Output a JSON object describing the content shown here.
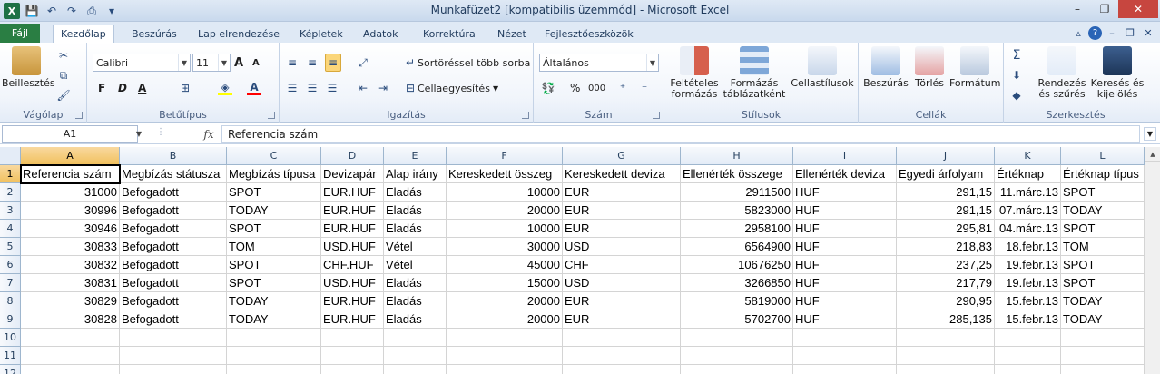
{
  "window": {
    "title": "Munkafüzet2  [kompatibilis üzemmód]  -  Microsoft Excel",
    "minimize": "–",
    "restore": "❐",
    "close": "✕"
  },
  "tabs": [
    {
      "label": "Fájl"
    },
    {
      "label": "Kezdőlap"
    },
    {
      "label": "Beszúrás"
    },
    {
      "label": "Lap elrendezése"
    },
    {
      "label": "Képletek"
    },
    {
      "label": "Adatok"
    },
    {
      "label": "Korrektúra"
    },
    {
      "label": "Nézet"
    },
    {
      "label": "Fejlesztőeszközök"
    }
  ],
  "ribbon": {
    "clipboard": {
      "label": "Vágólap",
      "paste": "Beillesztés"
    },
    "font": {
      "label": "Betűtípus",
      "name": "Calibri",
      "size": "11",
      "bold": "F",
      "italic": "D",
      "underline": "A",
      "grow": "A",
      "shrink": "A"
    },
    "alignment": {
      "label": "Igazítás",
      "wrap": "Sortöréssel több sorba",
      "merge": "Cellaegyesítés"
    },
    "number": {
      "label": "Szám",
      "format": "Általános",
      "percent": "%",
      "thousands": "000"
    },
    "styles": {
      "label": "Stílusok",
      "conditional1": "Feltételes",
      "conditional2": "formázás",
      "table1": "Formázás",
      "table2": "táblázatként",
      "cellstyles": "Cellastílusok"
    },
    "cells": {
      "label": "Cellák",
      "insert": "Beszúrás",
      "delete": "Törlés",
      "format": "Formátum"
    },
    "editing": {
      "label": "Szerkesztés",
      "sort1": "Rendezés",
      "sort2": "és szűrés",
      "find1": "Keresés és",
      "find2": "kijelölés"
    }
  },
  "formula_bar": {
    "name_box": "A1",
    "fx": "fx",
    "value": "Referencia szám"
  },
  "columns": [
    "A",
    "B",
    "C",
    "D",
    "E",
    "F",
    "G",
    "H",
    "I",
    "J",
    "K",
    "L"
  ],
  "rows": [
    "1",
    "2",
    "3",
    "4",
    "5",
    "6",
    "7",
    "8",
    "9",
    "10",
    "11",
    "12"
  ],
  "sheet": [
    [
      "Referencia szám",
      "Megbízás státusza",
      "Megbízás típusa",
      "Devizapár",
      "Alap irány",
      "Kereskedett összeg",
      "Kereskedett deviza",
      "Ellenérték összege",
      "Ellenérték deviza",
      "Egyedi árfolyam",
      "Értéknap",
      "Értéknap típus"
    ],
    [
      "31000",
      "Befogadott",
      "SPOT",
      "EUR.HUF",
      "Eladás",
      "10000",
      "EUR",
      "2911500",
      "HUF",
      "291,15",
      "11.márc.13",
      "SPOT"
    ],
    [
      "30996",
      "Befogadott",
      "TODAY",
      "EUR.HUF",
      "Eladás",
      "20000",
      "EUR",
      "5823000",
      "HUF",
      "291,15",
      "07.márc.13",
      "TODAY"
    ],
    [
      "30946",
      "Befogadott",
      "SPOT",
      "EUR.HUF",
      "Eladás",
      "10000",
      "EUR",
      "2958100",
      "HUF",
      "295,81",
      "04.márc.13",
      "SPOT"
    ],
    [
      "30833",
      "Befogadott",
      "TOM",
      "USD.HUF",
      "Vétel",
      "30000",
      "USD",
      "6564900",
      "HUF",
      "218,83",
      "18.febr.13",
      "TOM"
    ],
    [
      "30832",
      "Befogadott",
      "SPOT",
      "CHF.HUF",
      "Vétel",
      "45000",
      "CHF",
      "10676250",
      "HUF",
      "237,25",
      "19.febr.13",
      "SPOT"
    ],
    [
      "30831",
      "Befogadott",
      "SPOT",
      "USD.HUF",
      "Eladás",
      "15000",
      "USD",
      "3266850",
      "HUF",
      "217,79",
      "19.febr.13",
      "SPOT"
    ],
    [
      "30829",
      "Befogadott",
      "TODAY",
      "EUR.HUF",
      "Eladás",
      "20000",
      "EUR",
      "5819000",
      "HUF",
      "290,95",
      "15.febr.13",
      "TODAY"
    ],
    [
      "30828",
      "Befogadott",
      "TODAY",
      "EUR.HUF",
      "Eladás",
      "20000",
      "EUR",
      "5702700",
      "HUF",
      "285,135",
      "15.febr.13",
      "TODAY"
    ]
  ]
}
